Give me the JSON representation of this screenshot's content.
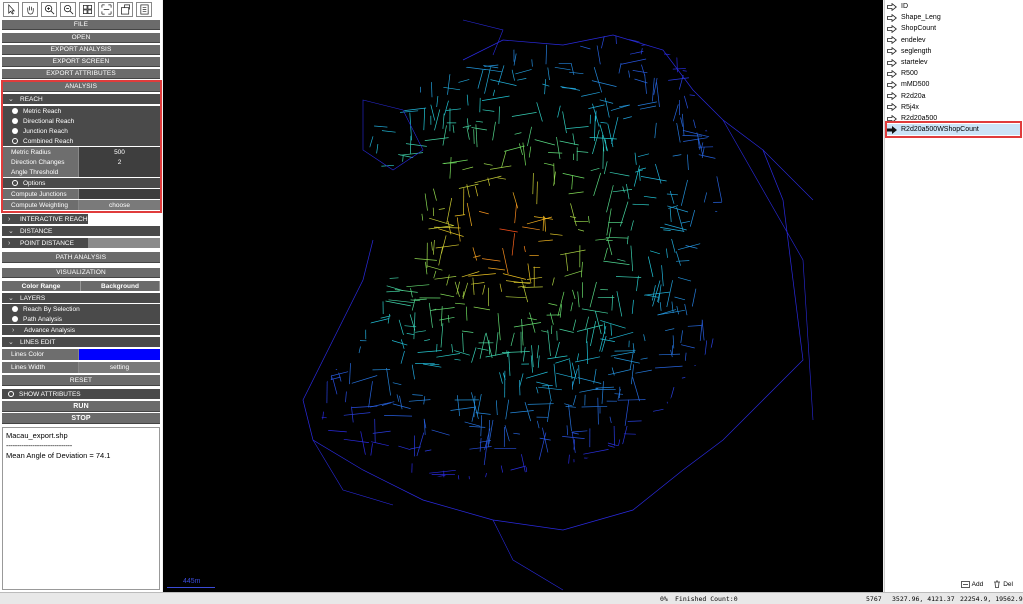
{
  "toolbar": {
    "tools": [
      {
        "icon": "pointer-icon"
      },
      {
        "icon": "hand-pan-icon"
      },
      {
        "icon": "zoom-in-icon"
      },
      {
        "icon": "zoom-out-icon"
      },
      {
        "icon": "grid-icon"
      },
      {
        "icon": "fit-extent-icon"
      },
      {
        "icon": "export-icon"
      },
      {
        "icon": "list-icon"
      }
    ]
  },
  "menu": {
    "file": "FILE",
    "open": "OPEN",
    "export_analysis": "EXPORT ANALYSIS",
    "export_screen": "EXPORT SCREEN",
    "export_attributes": "EXPORT ATTRIBUTES"
  },
  "analysis": {
    "title": "ANALYSIS",
    "reach_header": "REACH",
    "options": [
      {
        "label": "Metric Reach",
        "selected": true
      },
      {
        "label": "Directional Reach",
        "selected": true
      },
      {
        "label": "Junction Reach",
        "selected": true
      },
      {
        "label": "Combined Reach",
        "selected": false
      }
    ],
    "params": {
      "metric_radius_label": "Metric Radius",
      "metric_radius_value": "500",
      "direction_changes_label": "Direction Changes",
      "direction_changes_value": "2",
      "angle_threshold_label": "Angle Threshold",
      "angle_threshold_value": ""
    },
    "options_label": "Options",
    "compute_junctions_label": "Compute Junctions",
    "compute_weighting_label": "Compute Weighting",
    "compute_weighting_button": "choose",
    "interactive_reach": "INTERACTIVE REACH",
    "distance": "DISTANCE",
    "point_distance": "POINT DISTANCE",
    "path_analysis": "PATH ANALYSIS"
  },
  "visualization": {
    "title": "VISUALIZATION",
    "color_range": "Color Range",
    "background": "Background",
    "layers_header": "LAYERS",
    "reach_by_selection": "Reach By Selection",
    "path_analysis": "Path Analysis",
    "advance_analysis": "Advance Analysis",
    "lines_edit_header": "LINES EDIT",
    "lines_color_label": "Lines Color",
    "lines_color": "#0000ff",
    "lines_width_label": "Lines Width",
    "lines_width_button": "setting",
    "reset": "RESET"
  },
  "show_attributes": "SHOW ATTRIBUTES",
  "run": "RUN",
  "stop": "STOP",
  "console": {
    "file": "Macau_export.shp",
    "separator": "------------------------------",
    "result": "Mean Angle of Deviation = 74.1"
  },
  "map": {
    "scale_label": "445m",
    "background": "#000000"
  },
  "attributes": {
    "items": [
      "ID",
      "Shape_Leng",
      "ShopCount",
      "endelev",
      "seglength",
      "startelev",
      "R500",
      "mMD500",
      "R2d20a",
      "R5j4x",
      "R2d20a500"
    ],
    "selected": "R2d20a500WShopCount",
    "add_button": "Add",
    "del_button": "Del"
  },
  "status": {
    "progress": "0%",
    "finished": "Finished Count:0",
    "count": "5767",
    "coords_a": "3527.96,  4121.37",
    "coords_b": "22254.9,  19562.9"
  },
  "colors": {
    "panel_gray": "#6b6b6b",
    "panel_dark": "#4a4a4a",
    "highlight_red": "#e03c3c",
    "selection_blue": "#cce4f7"
  }
}
